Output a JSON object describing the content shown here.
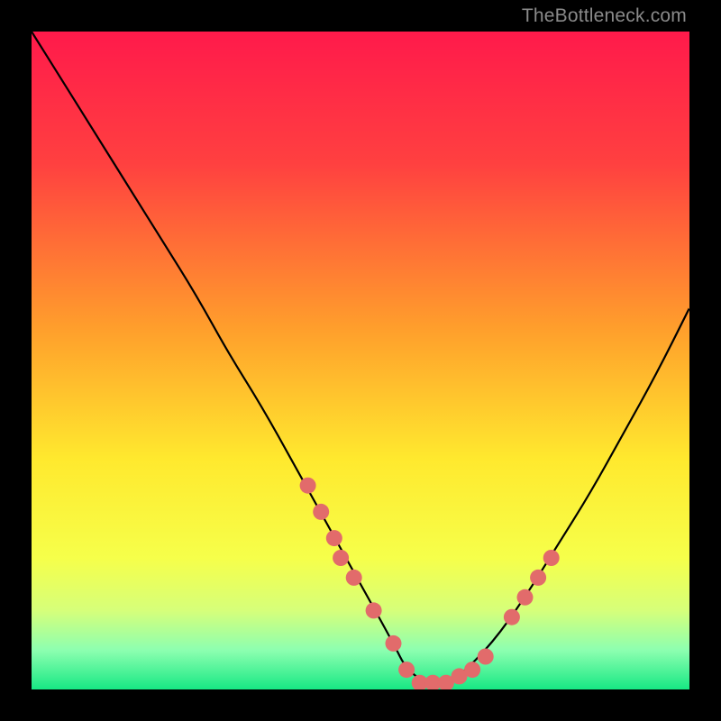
{
  "watermark": "TheBottleneck.com",
  "chart_data": {
    "type": "line",
    "title": "",
    "xlabel": "",
    "ylabel": "",
    "xlim": [
      0,
      100
    ],
    "ylim": [
      0,
      100
    ],
    "gradient_stops": [
      {
        "offset": 0,
        "color": "#ff1a4b"
      },
      {
        "offset": 20,
        "color": "#ff4040"
      },
      {
        "offset": 45,
        "color": "#ff9e2c"
      },
      {
        "offset": 65,
        "color": "#ffe92e"
      },
      {
        "offset": 80,
        "color": "#f6ff4a"
      },
      {
        "offset": 88,
        "color": "#d6ff7a"
      },
      {
        "offset": 94,
        "color": "#8dffb0"
      },
      {
        "offset": 100,
        "color": "#17e884"
      }
    ],
    "series": [
      {
        "name": "bottleneck-curve",
        "x": [
          0,
          5,
          10,
          15,
          20,
          25,
          30,
          35,
          40,
          45,
          50,
          55,
          57,
          60,
          63,
          65,
          70,
          75,
          80,
          85,
          90,
          95,
          100
        ],
        "values": [
          100,
          92,
          84,
          76,
          68,
          60,
          51,
          43,
          34,
          25,
          16,
          7,
          3,
          1,
          1,
          2,
          7,
          14,
          22,
          30,
          39,
          48,
          58
        ]
      }
    ],
    "markers": {
      "name": "sample-points",
      "color": "#e26b6b",
      "radius": 9,
      "points": [
        {
          "x": 42,
          "y": 31
        },
        {
          "x": 44,
          "y": 27
        },
        {
          "x": 46,
          "y": 23
        },
        {
          "x": 47,
          "y": 20
        },
        {
          "x": 49,
          "y": 17
        },
        {
          "x": 52,
          "y": 12
        },
        {
          "x": 55,
          "y": 7
        },
        {
          "x": 57,
          "y": 3
        },
        {
          "x": 59,
          "y": 1
        },
        {
          "x": 61,
          "y": 1
        },
        {
          "x": 63,
          "y": 1
        },
        {
          "x": 65,
          "y": 2
        },
        {
          "x": 67,
          "y": 3
        },
        {
          "x": 69,
          "y": 5
        },
        {
          "x": 73,
          "y": 11
        },
        {
          "x": 75,
          "y": 14
        },
        {
          "x": 77,
          "y": 17
        },
        {
          "x": 79,
          "y": 20
        }
      ]
    }
  }
}
